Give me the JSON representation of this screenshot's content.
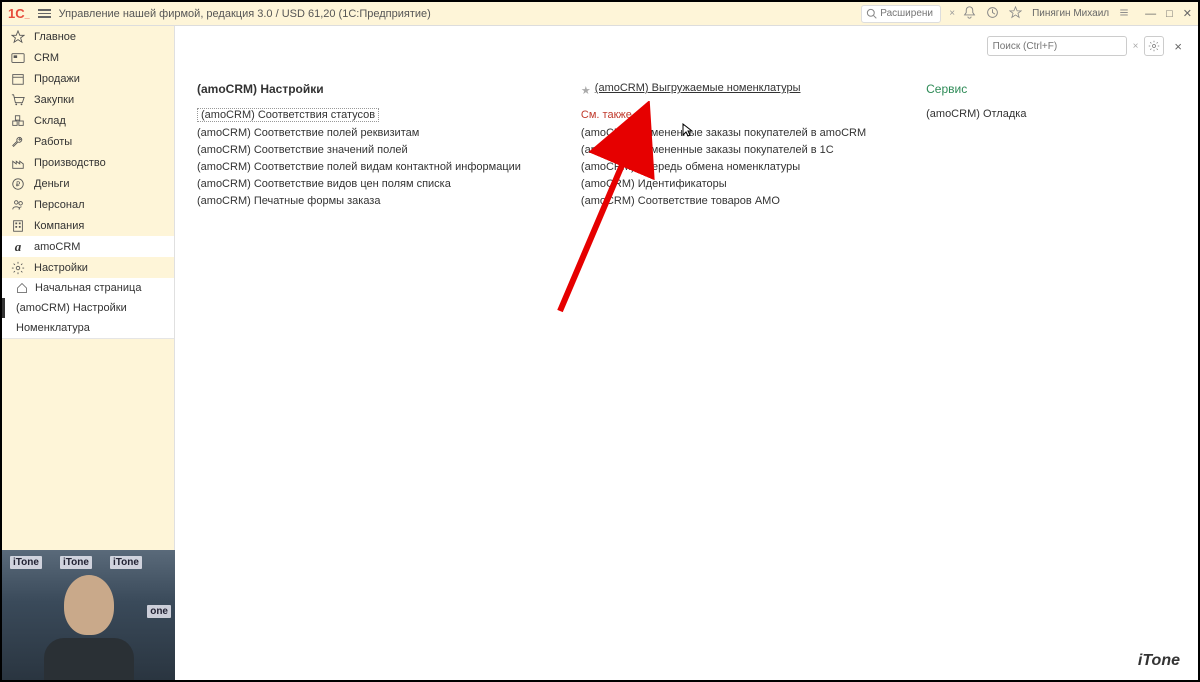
{
  "titlebar": {
    "title": "Управление нашей фирмой, редакция 3.0 / USD 61,20  (1С:Предприятие)",
    "search_placeholder": "Расширени",
    "user": "Пинягин Михаил"
  },
  "sidebar": {
    "items": [
      {
        "icon": "star",
        "label": "Главное"
      },
      {
        "icon": "crm",
        "label": "CRM"
      },
      {
        "icon": "calendar",
        "label": "Продажи"
      },
      {
        "icon": "cart",
        "label": "Закупки"
      },
      {
        "icon": "boxes",
        "label": "Склад"
      },
      {
        "icon": "wrench",
        "label": "Работы"
      },
      {
        "icon": "factory",
        "label": "Производство"
      },
      {
        "icon": "ruble",
        "label": "Деньги"
      },
      {
        "icon": "people",
        "label": "Персонал"
      },
      {
        "icon": "building",
        "label": "Компания"
      },
      {
        "icon": "amocrm",
        "label": "amoCRM"
      },
      {
        "icon": "gear",
        "label": "Настройки"
      }
    ],
    "submenu": [
      {
        "icon": "home",
        "label": "Начальная страница"
      },
      {
        "icon": "",
        "label": "(amoCRM) Настройки"
      },
      {
        "icon": "",
        "label": "Номенклатура"
      }
    ]
  },
  "main": {
    "search_placeholder": "Поиск (Ctrl+F)",
    "col1": {
      "head": "(amoCRM) Настройки",
      "items": [
        "(amoCRM) Соответствия статусов",
        "(amoCRM) Соответствие полей реквизитам",
        "(amoCRM) Соответствие значений полей",
        "(amoCRM) Соответствие полей видам контактной информации",
        "(amoCRM) Соответствие видов цен полям списка",
        "(amoCRM) Печатные формы заказа"
      ]
    },
    "col2": {
      "starlink": "(amoCRM) Выгружаемые номенклатуры",
      "seealso": "См. также",
      "items": [
        "(amoCRM) Измененные заказы покупателей в amoCRM",
        "(amoCRM) Измененные заказы покупателей в 1С",
        "(amoCRM) Очередь обмена номенклатуры",
        "(amoCRM) Идентификаторы",
        "(amoCRM) Соответствие товаров АМО"
      ]
    },
    "col3": {
      "head": "Сервис",
      "items": [
        "(amoCRM) Отладка"
      ]
    }
  },
  "footer": {
    "logo": "iTone"
  },
  "webcam_tags": [
    "iTone",
    "iTone",
    "iTone",
    "one"
  ]
}
